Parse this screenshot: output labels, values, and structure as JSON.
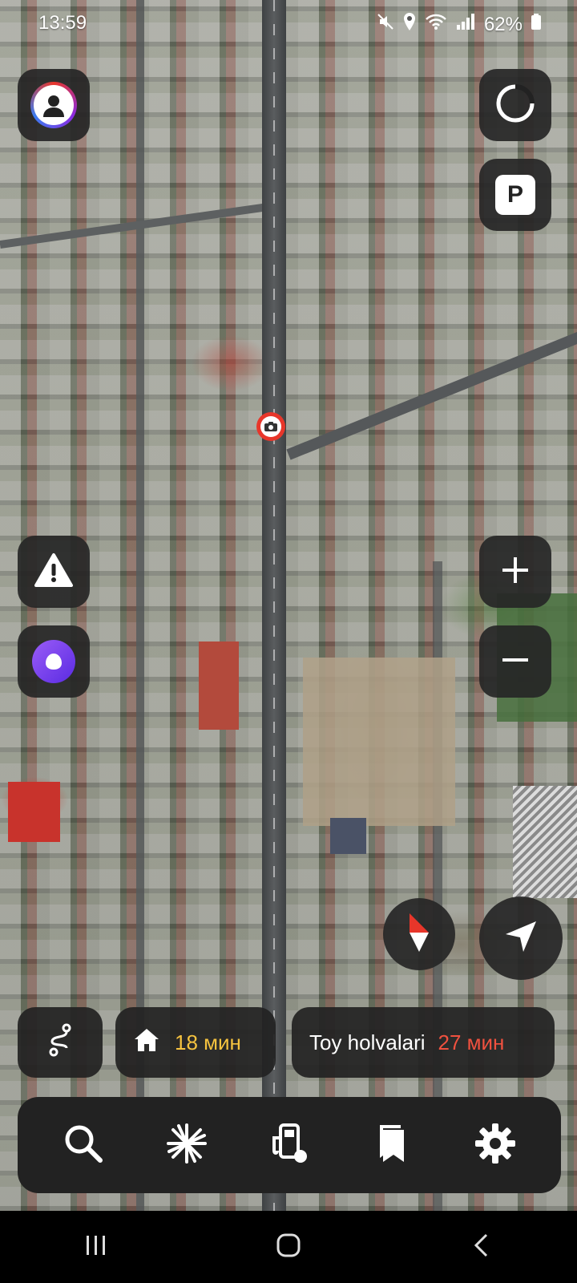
{
  "status_bar": {
    "time": "13:59",
    "battery": "62%"
  },
  "map": {
    "marker_icon": "camera-icon",
    "buttons": {
      "profile": "profile-icon",
      "layers": "layers-icon",
      "parking": "P",
      "alert": "warning-icon",
      "assistant": "alice-icon",
      "zoom_in": "plus-icon",
      "zoom_out": "minus-icon",
      "compass": "compass-icon",
      "locate": "navigation-arrow-icon"
    }
  },
  "routes": {
    "home": {
      "icon": "home-icon",
      "time": "18 мин"
    },
    "favorite": {
      "name": "Toy holvalari",
      "time": "27 мин"
    },
    "route_icon": "route-icon"
  },
  "toolbar": {
    "items": [
      "search-icon",
      "discovery-icon",
      "gas-station-icon",
      "bookmarks-icon",
      "settings-icon"
    ]
  },
  "colors": {
    "accent_yellow": "#f6c33f",
    "accent_red": "#f0513f",
    "alice_purple": "#6b3cf0",
    "panel_dark": "#222222"
  }
}
